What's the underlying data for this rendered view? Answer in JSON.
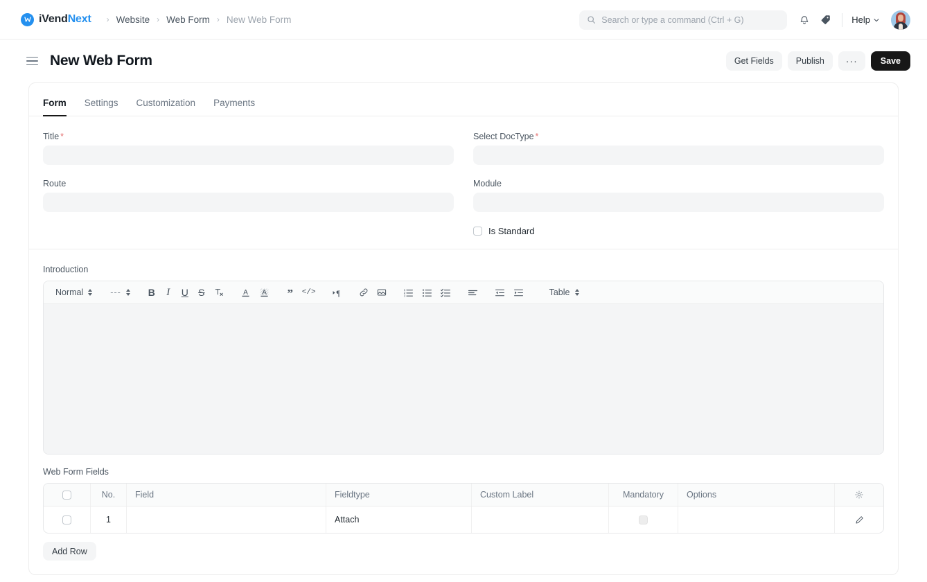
{
  "navbar": {
    "brand": {
      "prefix": "iVend",
      "suffix": "Next",
      "mark": "W"
    },
    "breadcrumbs": [
      {
        "label": "Website",
        "muted": false
      },
      {
        "label": "Web Form",
        "muted": false
      },
      {
        "label": "New Web Form",
        "muted": true
      }
    ],
    "separator": "›",
    "search": {
      "placeholder": "Search or type a command (Ctrl + G)",
      "value": ""
    },
    "icons": {
      "bell": "notifications-icon",
      "tag": "tag-icon"
    },
    "help_label": "Help"
  },
  "page": {
    "title": "New Web Form",
    "actions": [
      {
        "label": "Get Fields",
        "style": "default"
      },
      {
        "label": "Publish",
        "style": "default"
      },
      {
        "label": "···",
        "style": "ellipsis"
      },
      {
        "label": "Save",
        "style": "primary"
      }
    ]
  },
  "tabs": [
    {
      "label": "Form",
      "active": true
    },
    {
      "label": "Settings",
      "active": false
    },
    {
      "label": "Customization",
      "active": false
    },
    {
      "label": "Payments",
      "active": false
    }
  ],
  "form": {
    "title": {
      "label": "Title",
      "required": true,
      "value": "",
      "placeholder": ""
    },
    "route": {
      "label": "Route",
      "required": false,
      "value": "",
      "placeholder": ""
    },
    "doctype": {
      "label": "Select DocType",
      "required": true,
      "value": "",
      "placeholder": ""
    },
    "module": {
      "label": "Module",
      "required": false,
      "value": "",
      "placeholder": ""
    },
    "is_standard": {
      "label": "Is Standard",
      "checked": false
    }
  },
  "introduction": {
    "label": "Introduction",
    "content": "",
    "toolbar": {
      "style_select": "Normal",
      "heading_select": "---",
      "table_select": "Table",
      "buttons": [
        {
          "name": "bold",
          "glyph": "B"
        },
        {
          "name": "italic",
          "glyph": "I"
        },
        {
          "name": "underline",
          "glyph": "U"
        },
        {
          "name": "strikethrough",
          "glyph": "S"
        },
        {
          "name": "clear-formatting",
          "glyph": "Tx"
        },
        {
          "name": "font-color",
          "glyph": "A"
        },
        {
          "name": "background-color",
          "glyph": "A"
        },
        {
          "name": "blockquote",
          "glyph": "”"
        },
        {
          "name": "code-block",
          "glyph": "</>"
        },
        {
          "name": "text-direction",
          "glyph": "¶"
        },
        {
          "name": "link",
          "glyph": "link"
        },
        {
          "name": "image",
          "glyph": "image"
        },
        {
          "name": "ordered-list",
          "glyph": "ol"
        },
        {
          "name": "bullet-list",
          "glyph": "ul"
        },
        {
          "name": "check-list",
          "glyph": "cl"
        },
        {
          "name": "align",
          "glyph": "align"
        },
        {
          "name": "outdent",
          "glyph": "outdent"
        },
        {
          "name": "indent",
          "glyph": "indent"
        }
      ]
    }
  },
  "web_form_fields": {
    "label": "Web Form Fields",
    "columns": [
      "",
      "No.",
      "Field",
      "Fieldtype",
      "Custom Label",
      "Mandatory",
      "Options",
      ""
    ],
    "rows": [
      {
        "selected": false,
        "no": "1",
        "field": "",
        "fieldtype": "Attach",
        "custom_label": "",
        "mandatory": false,
        "options": ""
      }
    ],
    "add_row_label": "Add Row"
  },
  "colors": {
    "accent": "#2490ef",
    "primary_button": "#171717",
    "required": "#e57373",
    "input_bg": "#f4f5f6",
    "border": "#ededed",
    "text": "#1f272e",
    "muted_text": "#6b7683"
  }
}
